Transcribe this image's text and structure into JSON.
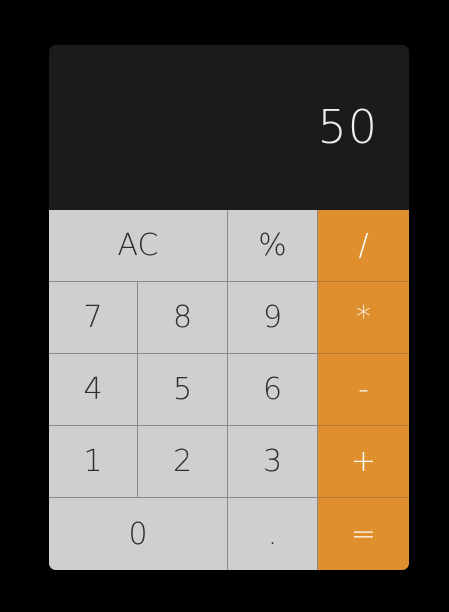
{
  "display": {
    "value": "50"
  },
  "keys": {
    "clear": "AC",
    "percent": "%",
    "divide": "/",
    "seven": "7",
    "eight": "8",
    "nine": "9",
    "multiply": "*",
    "four": "4",
    "five": "5",
    "six": "6",
    "subtract": "-",
    "one": "1",
    "two": "2",
    "three": "3",
    "add": "+",
    "zero": "0",
    "decimal": ".",
    "equals": "="
  },
  "colors": {
    "display_background": "#1c1b1b",
    "key_background": "#cfcfcf",
    "operator_background": "#df8f2e",
    "page_background": "#000000"
  }
}
